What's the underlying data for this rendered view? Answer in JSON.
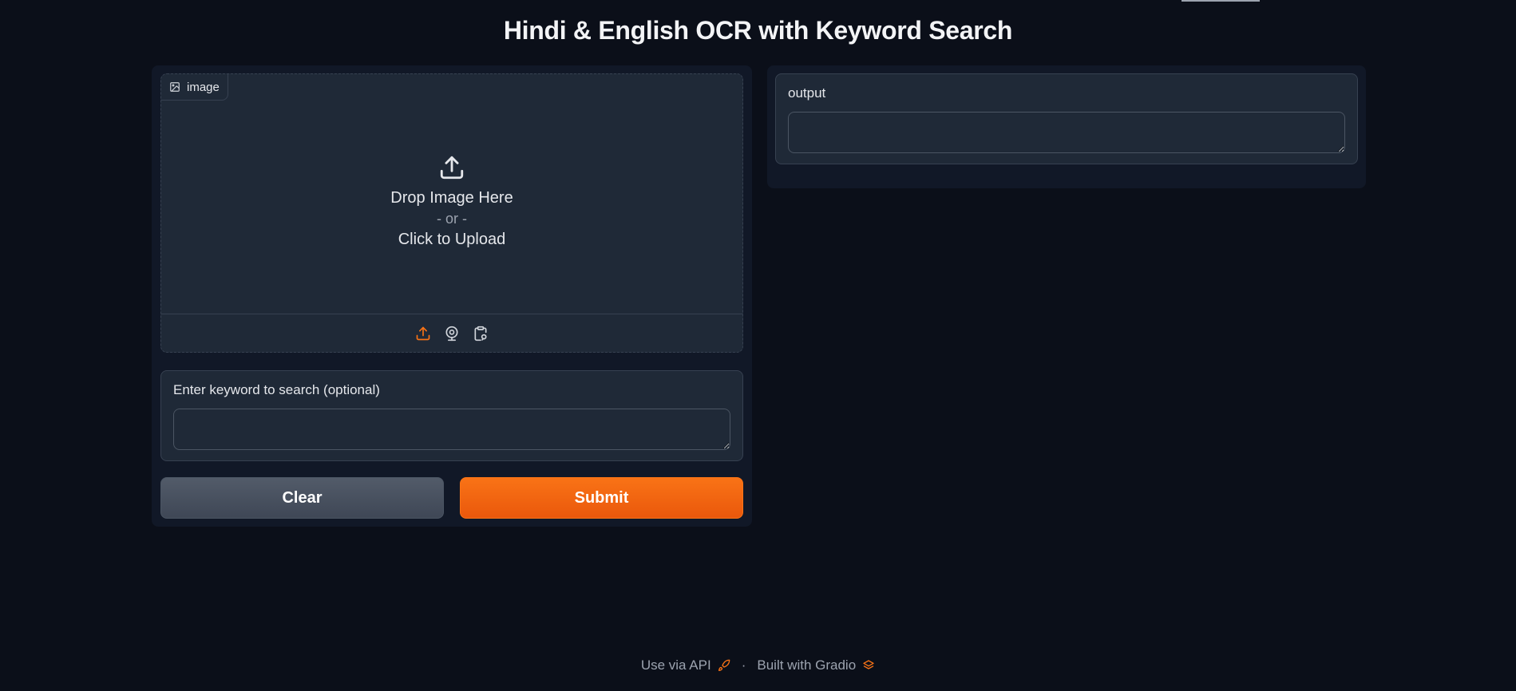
{
  "page": {
    "title": "Hindi & English OCR with Keyword Search"
  },
  "image_input": {
    "label": "image",
    "drop_text": "Drop Image Here",
    "or_text": "- or -",
    "click_text": "Click to Upload",
    "sources": [
      "upload-icon",
      "webcam-icon",
      "clipboard-icon"
    ],
    "active_source_color": "#f97316"
  },
  "keyword_input": {
    "label": "Enter keyword to search (optional)",
    "value": ""
  },
  "output": {
    "label": "output",
    "value": ""
  },
  "buttons": {
    "clear": "Clear",
    "submit": "Submit"
  },
  "footer": {
    "api_text": "Use via API",
    "separator": "·",
    "built_text": "Built with Gradio"
  },
  "colors": {
    "background": "#0b0f19",
    "panel": "#111827",
    "block": "#1f2937",
    "accent": "#f97316"
  }
}
